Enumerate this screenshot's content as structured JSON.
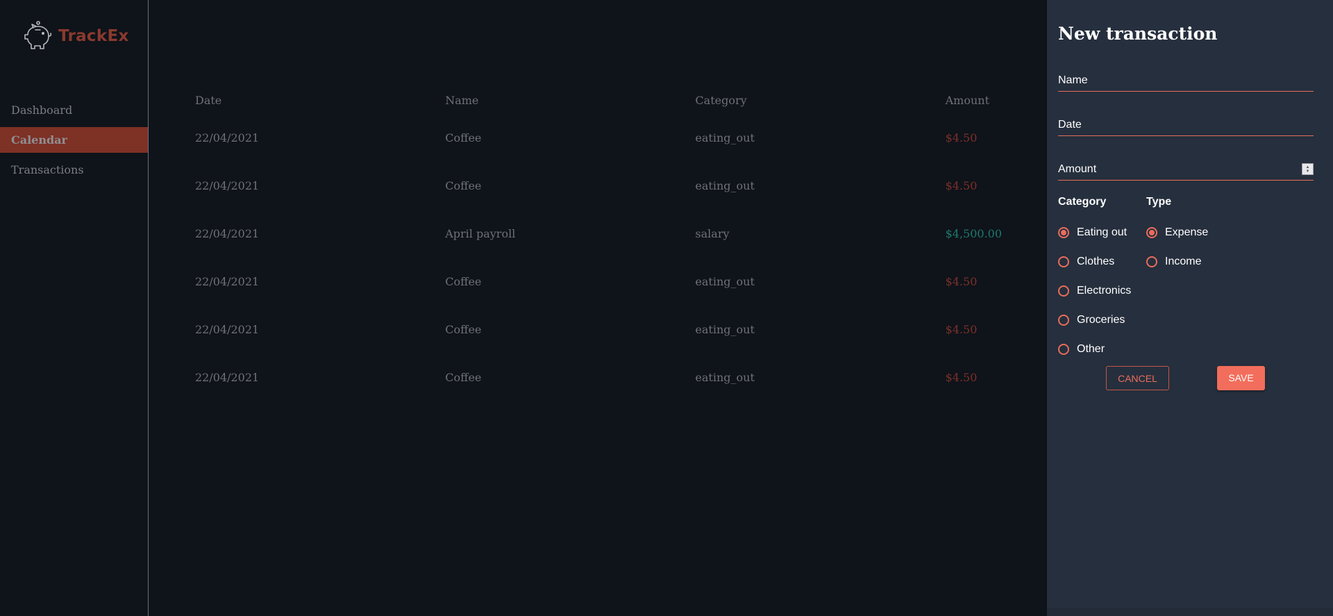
{
  "app": {
    "name": "TrackEx",
    "brand_color": "#8a3a2e",
    "accent_color": "#e96d5c"
  },
  "sidebar": {
    "logo_icon": "piggy-bank-icon",
    "items": [
      {
        "label": "Dashboard",
        "active": false
      },
      {
        "label": "Calendar",
        "active": true
      },
      {
        "label": "Transactions",
        "active": false
      }
    ]
  },
  "table": {
    "headers": [
      "Date",
      "Name",
      "Category",
      "Amount"
    ],
    "rows": [
      {
        "date": "22/04/2021",
        "name": "Coffee",
        "category": "eating_out",
        "amount": "$4.50",
        "type": "expense"
      },
      {
        "date": "22/04/2021",
        "name": "Coffee",
        "category": "eating_out",
        "amount": "$4.50",
        "type": "expense"
      },
      {
        "date": "22/04/2021",
        "name": "April payroll",
        "category": "salary",
        "amount": "$4,500.00",
        "type": "income"
      },
      {
        "date": "22/04/2021",
        "name": "Coffee",
        "category": "eating_out",
        "amount": "$4.50",
        "type": "expense"
      },
      {
        "date": "22/04/2021",
        "name": "Coffee",
        "category": "eating_out",
        "amount": "$4.50",
        "type": "expense"
      },
      {
        "date": "22/04/2021",
        "name": "Coffee",
        "category": "eating_out",
        "amount": "$4.50",
        "type": "expense"
      }
    ],
    "expense_color": "#7a3128",
    "income_color": "#1d7a6c"
  },
  "panel": {
    "title": "New transaction",
    "fields": {
      "name_placeholder": "Name",
      "date_placeholder": "Date",
      "amount_placeholder": "Amount"
    },
    "category": {
      "title": "Category",
      "options": [
        "Eating out",
        "Clothes",
        "Electronics",
        "Groceries",
        "Other"
      ],
      "selected": "Eating out"
    },
    "type": {
      "title": "Type",
      "options": [
        "Expense",
        "Income"
      ],
      "selected": "Expense"
    },
    "cancel_label": "Cancel",
    "save_label": "Save"
  }
}
